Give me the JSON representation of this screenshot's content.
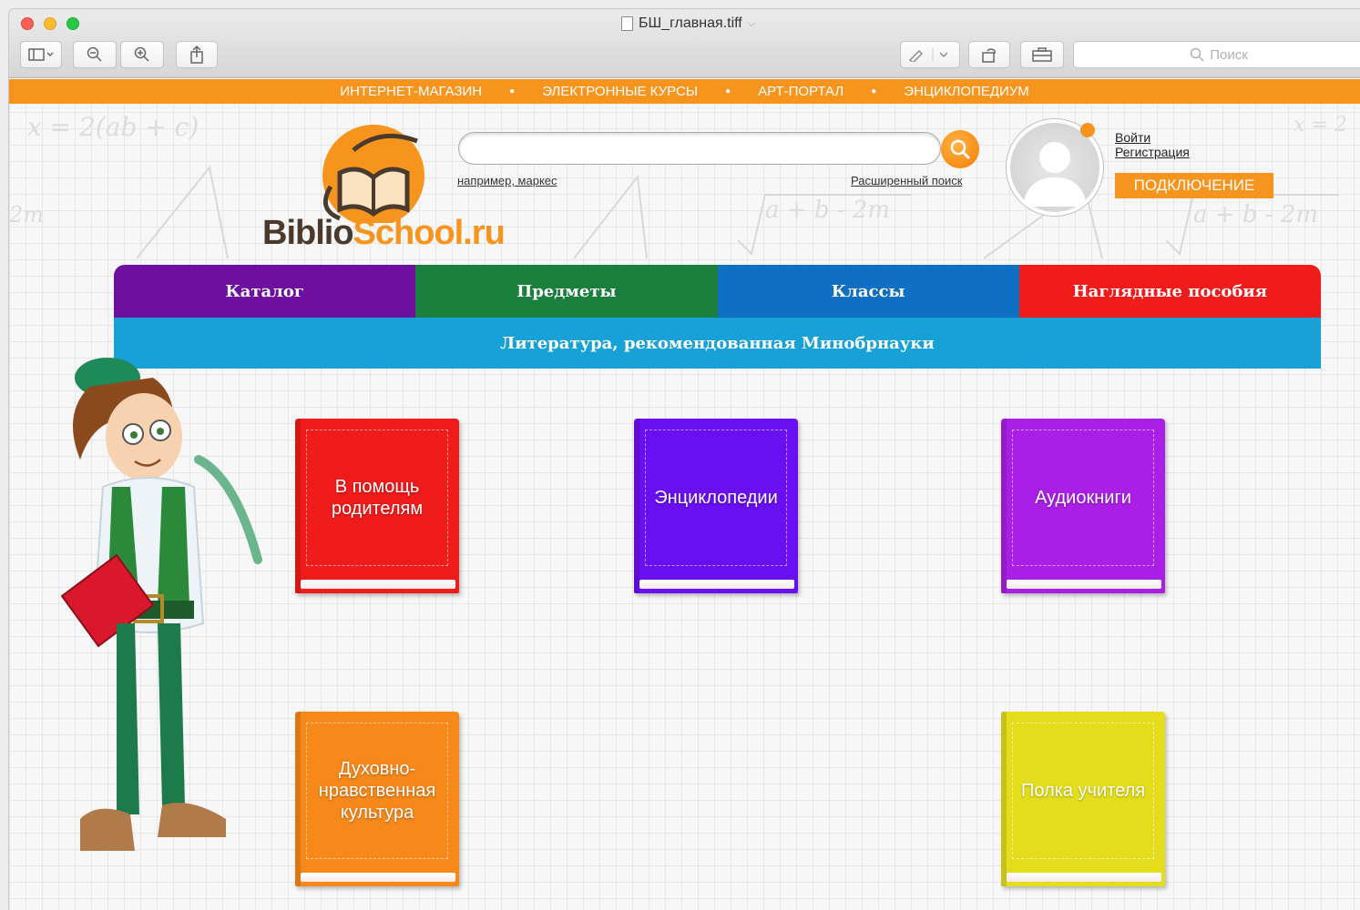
{
  "window": {
    "title": "БШ_главная.tiff",
    "toolbar_search_placeholder": "Поиск"
  },
  "site": {
    "top_links": [
      "ИНТЕРНЕТ-МАГАЗИН",
      "ЭЛЕКТРОННЫЕ КУРСЫ",
      "АРТ-ПОРТАЛ",
      "ЭНЦИКЛОПЕДИУМ"
    ],
    "logo": {
      "part1": "Biblio",
      "part2": "School.ru"
    },
    "search": {
      "example": "например, маркес",
      "advanced": "Расширенный поиск"
    },
    "auth": {
      "login": "Войти",
      "register": "Регистрация",
      "connect": "ПОДКЛЮЧЕНИЕ"
    },
    "menu": [
      {
        "label": "Каталог",
        "color": "#6f0fa0"
      },
      {
        "label": "Предметы",
        "color": "#1a7f3c"
      },
      {
        "label": "Классы",
        "color": "#0f6fc2"
      },
      {
        "label": "Наглядные пособия",
        "color": "#f01b1b"
      }
    ],
    "submenu": "Литература, рекомендованная Минобрнауки",
    "books": [
      {
        "label": "В помощь родителям",
        "color": "#f01b1b"
      },
      {
        "label": "Энциклопедии",
        "color": "#6a0ff0"
      },
      {
        "label": "Аудиокниги",
        "color": "#a91fe6"
      },
      {
        "label": "Духовно-нравственная культура",
        "color": "#f7881a"
      },
      {
        "label": "Полка учителя",
        "color": "#e3dd1c"
      }
    ],
    "colors": {
      "accent": "#f7941d",
      "submenu": "#17a1d6"
    }
  }
}
